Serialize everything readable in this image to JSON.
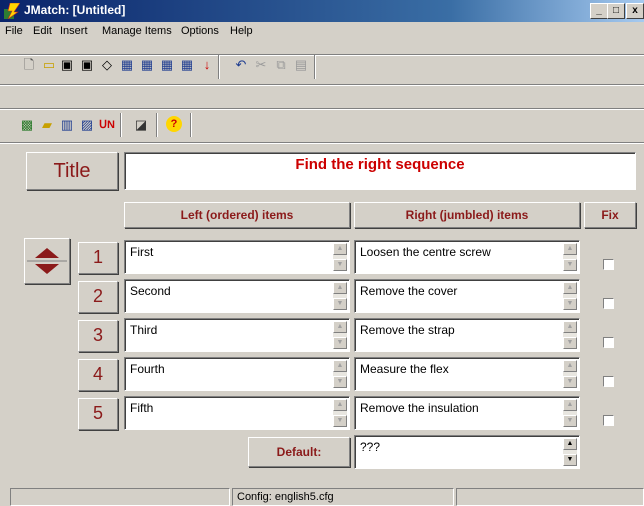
{
  "window": {
    "title": "JMatch: [Untitled]",
    "min": "_",
    "max": "□",
    "close": "x"
  },
  "menu": [
    "File",
    "Edit",
    "Insert",
    "Manage Items",
    "Options",
    "Help"
  ],
  "title_label": "Title",
  "title_value": "Find the right sequence",
  "headers": {
    "left": "Left (ordered) items",
    "right": "Right (jumbled) items",
    "fix": "Fix"
  },
  "rows": [
    {
      "num": "1",
      "left": "First",
      "right": "Loosen the centre screw",
      "fixed": false
    },
    {
      "num": "2",
      "left": "Second",
      "right": "Remove the cover",
      "fixed": false
    },
    {
      "num": "3",
      "left": "Third",
      "right": "Remove the strap",
      "fixed": false
    },
    {
      "num": "4",
      "left": "Fourth",
      "right": "Measure the flex",
      "fixed": false
    },
    {
      "num": "5",
      "left": "Fifth",
      "right": "Remove the insulation",
      "fixed": false
    }
  ],
  "default_label": "Default:",
  "default_value": "???",
  "status": {
    "config": "Config: english5.cfg"
  },
  "colors": {
    "label_text": "#8b1a1a",
    "window_bg": "#d4d0c8"
  }
}
